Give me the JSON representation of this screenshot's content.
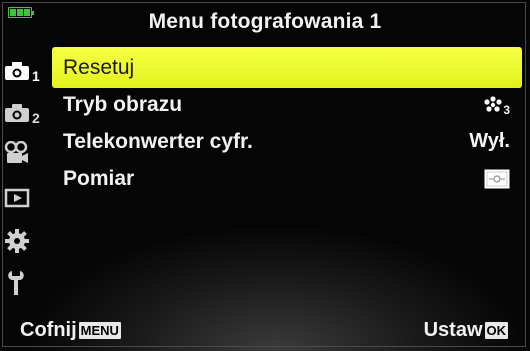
{
  "header": {
    "title": "Menu fotografowania 1",
    "battery_icon": "battery-full-icon"
  },
  "sidebar": {
    "items": [
      {
        "icon": "camera-icon",
        "number": "1",
        "active": true
      },
      {
        "icon": "camera-icon",
        "number": "2",
        "active": false
      },
      {
        "icon": "video-camera-icon",
        "number": "",
        "active": false
      },
      {
        "icon": "playback-icon",
        "number": "",
        "active": false
      },
      {
        "icon": "gear-icon",
        "number": "",
        "active": false
      },
      {
        "icon": "wrench-icon",
        "number": "",
        "active": false
      }
    ]
  },
  "menu": {
    "items": [
      {
        "label": "Resetuj",
        "value": "",
        "value_icon": "",
        "selected": true
      },
      {
        "label": "Tryb obrazu",
        "value": "",
        "value_icon": "picture-mode-3-icon",
        "selected": false
      },
      {
        "label": "Telekonwerter cyfr.",
        "value": "Wył.",
        "value_icon": "",
        "selected": false
      },
      {
        "label": "Pomiar",
        "value": "",
        "value_icon": "metering-mode-icon",
        "selected": false
      }
    ],
    "picture_mode_suffix": "3"
  },
  "footer": {
    "back_label": "Cofnij",
    "back_key": "MENU",
    "set_label": "Ustaw",
    "set_key": "OK"
  },
  "colors": {
    "highlight": "#e8f525",
    "battery": "#3fc33f",
    "text": "#f2f2f2"
  }
}
